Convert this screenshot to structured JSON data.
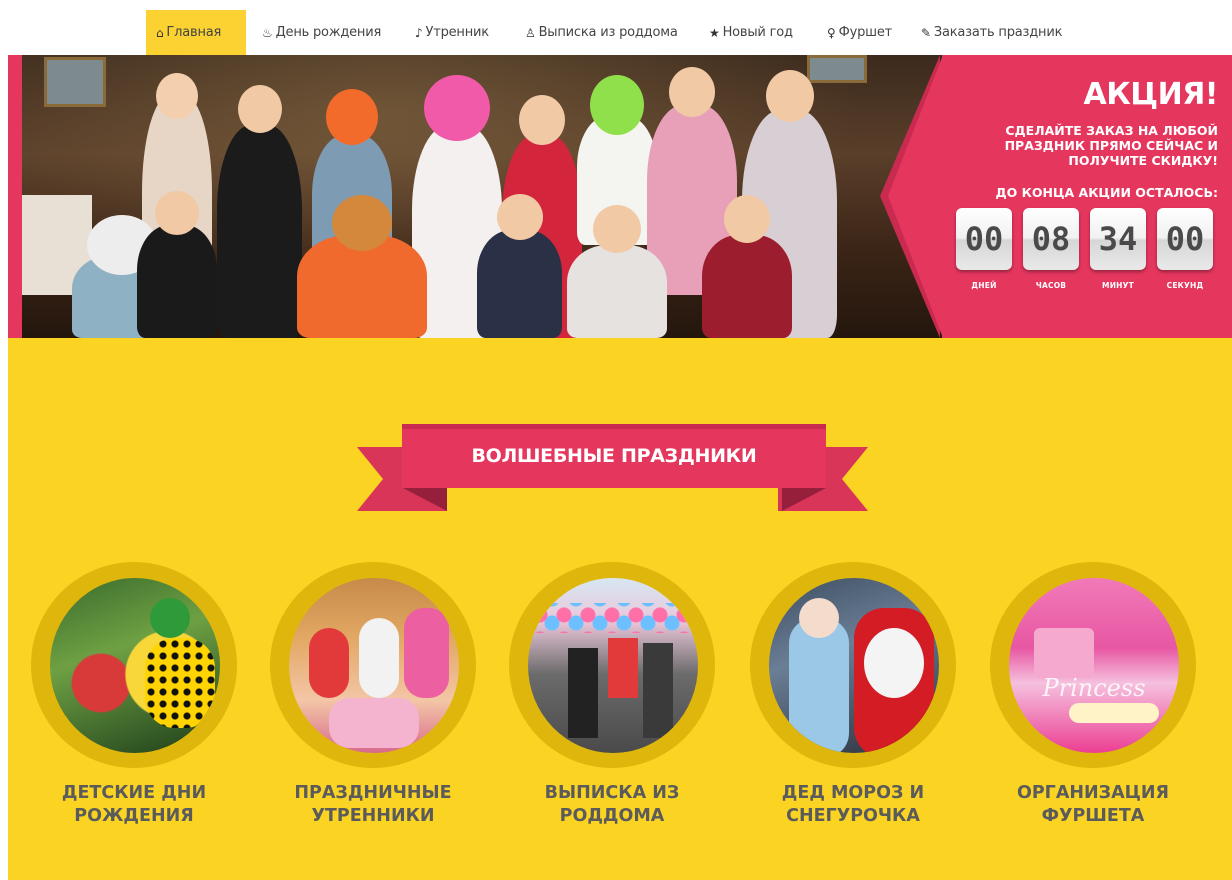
{
  "nav": {
    "items": [
      {
        "icon": "home-icon",
        "glyph": "⌂",
        "label": "Главная",
        "active": true
      },
      {
        "icon": "cake-icon",
        "glyph": "♨",
        "label": "День рождения",
        "active": false
      },
      {
        "icon": "bell-icon",
        "glyph": "♪",
        "label": "Утренник",
        "active": false
      },
      {
        "icon": "baby-icon",
        "glyph": "♙",
        "label": "Выписка из роддома",
        "active": false
      },
      {
        "icon": "star-icon",
        "glyph": "★",
        "label": "Новый год",
        "active": false
      },
      {
        "icon": "glass-icon",
        "glyph": "♀",
        "label": "Фуршет",
        "active": false
      },
      {
        "icon": "pencil-icon",
        "glyph": "✎",
        "label": "Заказать праздник",
        "active": false
      }
    ]
  },
  "promo": {
    "title": "АКЦИЯ!",
    "text": "СДЕЛАЙТЕ ЗАКАЗ НА ЛЮБОЙ ПРАЗДНИК ПРЯМО СЕЙЧАС И ПОЛУЧИТЕ СКИДКУ!",
    "deadline": "ДО КОНЦА АКЦИИ ОСТАЛОСЬ:",
    "countdown": [
      {
        "value": "00",
        "label": "ДНЕЙ"
      },
      {
        "value": "08",
        "label": "ЧАСОВ"
      },
      {
        "value": "34",
        "label": "МИНУТ"
      },
      {
        "value": "00",
        "label": "СЕКУНД"
      }
    ]
  },
  "section": {
    "title": "ВОЛШЕБНЫЕ ПРАЗДНИКИ"
  },
  "services": [
    {
      "title": "ДЕТСКИЕ ДНИ РОЖДЕНИЯ"
    },
    {
      "title": "ПРАЗДНИЧНЫЕ УТРЕННИКИ"
    },
    {
      "title": "ВЫПИСКА ИЗ РОДДОМА"
    },
    {
      "title": "ДЕД МОРОЗ И СНЕГУРОЧКА"
    },
    {
      "title": "ОРГАНИЗАЦИЯ ФУРШЕТА"
    }
  ],
  "photo_caption": "Princess",
  "colors": {
    "accent": "#e5365e",
    "yellow": "#fbd322",
    "nav_active": "#fbd232"
  }
}
